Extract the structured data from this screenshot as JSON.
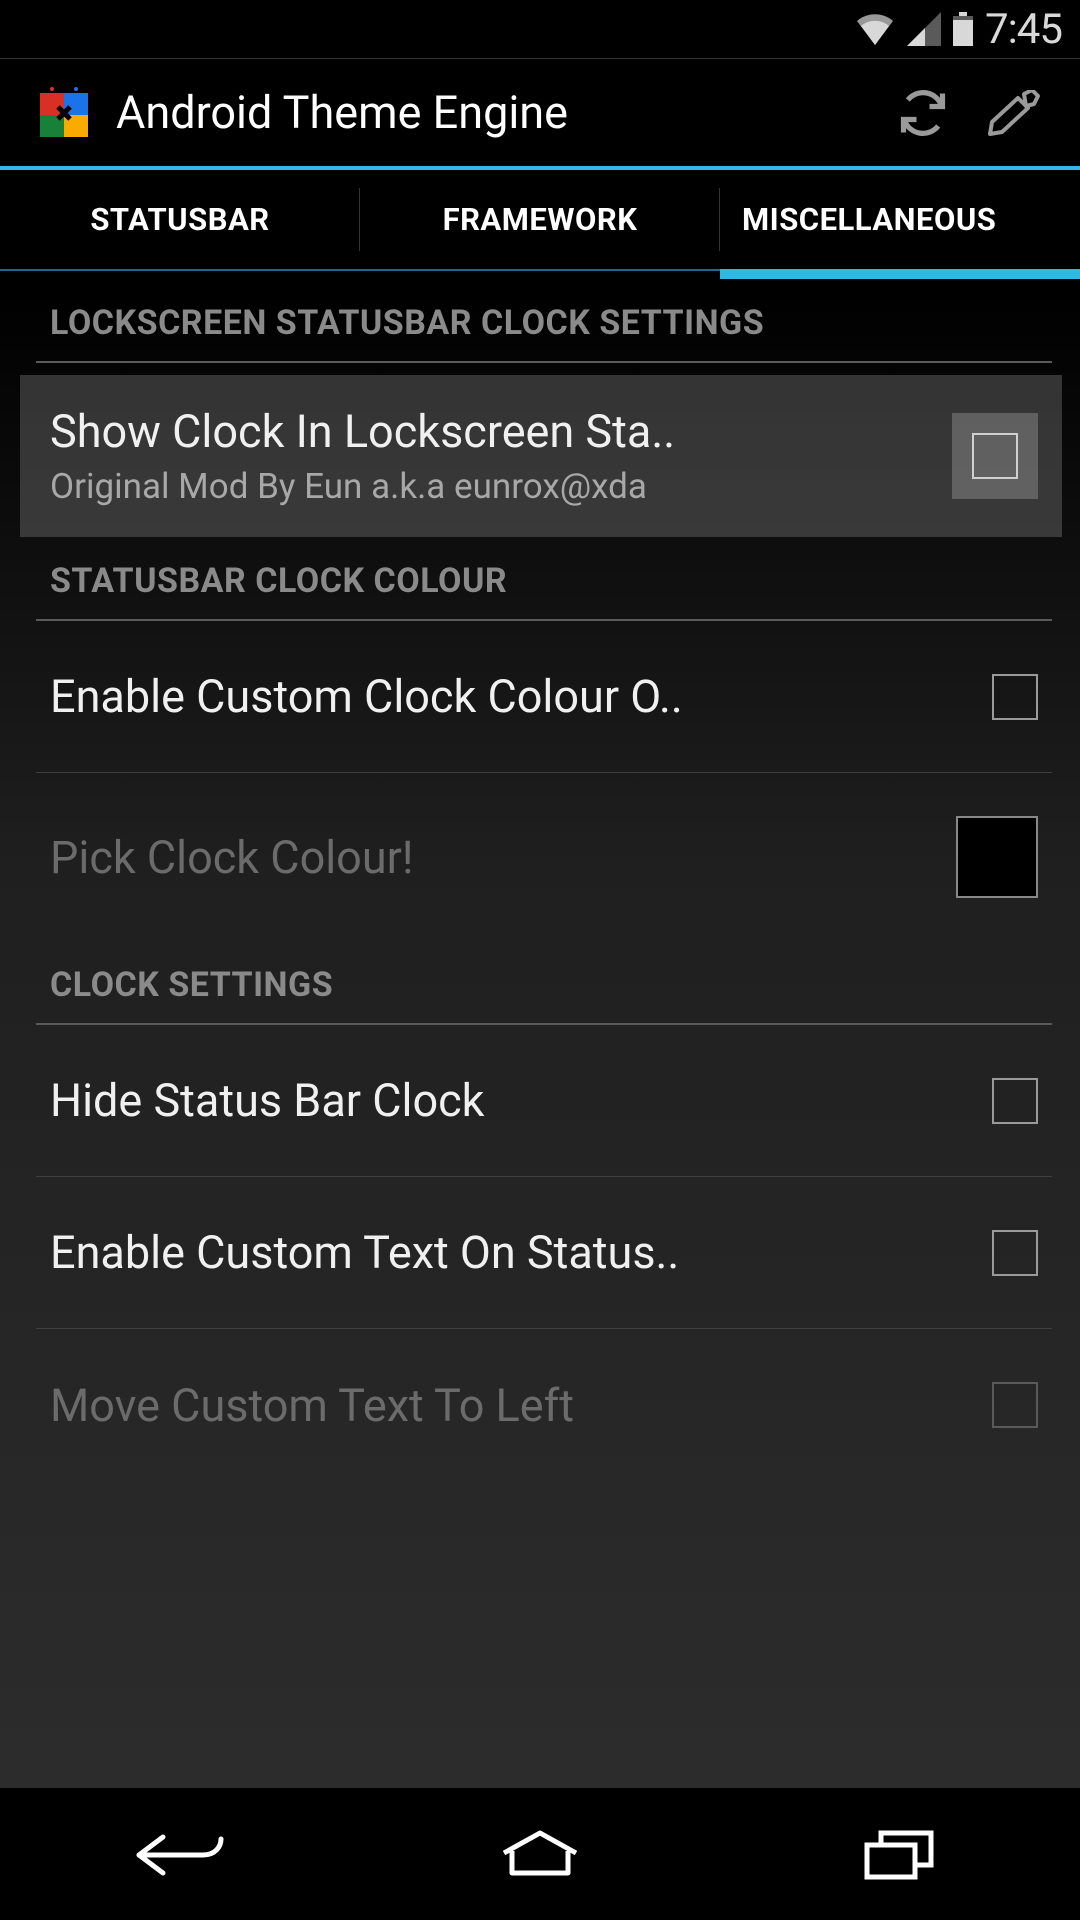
{
  "system": {
    "time": "7:45"
  },
  "appbar": {
    "title": "Android Theme Engine"
  },
  "tabs": {
    "statusbar": "STATUSBAR",
    "framework": "FRAMEWORK",
    "misc": "MISCELLANEOUS"
  },
  "sections": {
    "lockscreen_header": "LOCKSCREEN STATUSBAR CLOCK SETTINGS",
    "clock_colour_header": "STATUSBAR CLOCK COLOUR",
    "clock_settings_header": "CLOCK SETTINGS"
  },
  "items": {
    "show_clock_title": "Show Clock In Lockscreen Sta..",
    "show_clock_sub": "Original Mod By Eun a.k.a eunrox@xda",
    "enable_clock_colour": "Enable Custom Clock Colour O..",
    "pick_colour": "Pick Clock Colour!",
    "hide_clock": "Hide Status Bar Clock",
    "enable_custom_text": "Enable Custom Text On Status..",
    "move_text_left": "Move Custom Text To Left"
  }
}
